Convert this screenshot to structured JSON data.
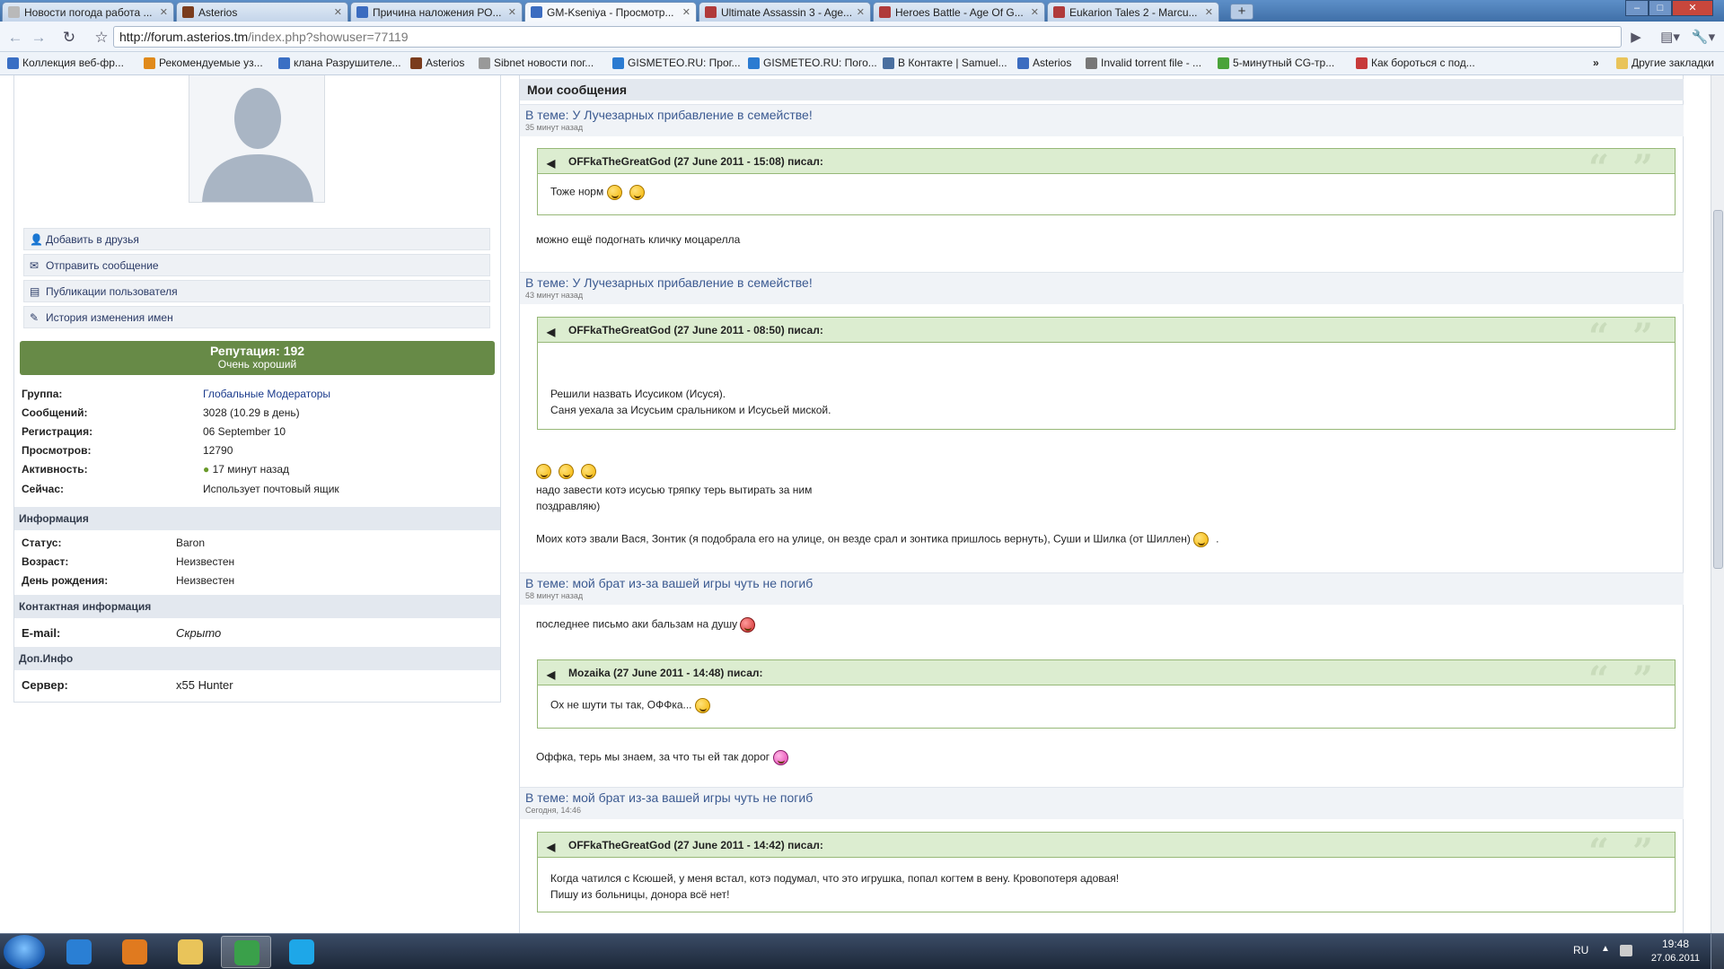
{
  "browser": {
    "tabs": [
      {
        "title": "Новости погода работа ...",
        "color": "#b9b9b9"
      },
      {
        "title": "Asterios",
        "color": "#7a3c1d"
      },
      {
        "title": "Причина наложения РО...",
        "color": "#3b6cc0"
      },
      {
        "title": "GM-Kseniya - Просмотр...",
        "color": "#3b6cc0"
      },
      {
        "title": "Ultimate Assassin 3 - Age...",
        "color": "#b03a3a"
      },
      {
        "title": "Heroes Battle - Age Of G...",
        "color": "#b03a3a"
      },
      {
        "title": "Eukarion Tales 2 - Marcu...",
        "color": "#b03a3a"
      }
    ],
    "active_tab": 3,
    "new_tab": "+",
    "url_host": "http://forum.asterios.tm",
    "url_path": "/index.php?showuser=77119",
    "window_controls": {
      "minimize": "–",
      "maximize": "□",
      "close": "✕"
    },
    "nav_icons": {
      "back": "back-arrow-icon",
      "forward": "forward-arrow-icon",
      "reload": "reload-icon",
      "star": "bookmark-star-icon"
    },
    "bookmarks": [
      {
        "label": "Коллекция веб-фр...",
        "color": "#3a6fc4"
      },
      {
        "label": "Рекомендуемые уз...",
        "color": "#e08a1b"
      },
      {
        "label": "клана Разрушителе...",
        "color": "#3a6fc4"
      },
      {
        "label": "Asterios",
        "color": "#7a3c1d"
      },
      {
        "label": "Sibnet новости пог...",
        "color": "#999999"
      },
      {
        "label": "GISMETEO.RU: Прог...",
        "color": "#2b7bd1"
      },
      {
        "label": "GISMETEO.RU: Пого...",
        "color": "#2b7bd1"
      },
      {
        "label": "В Контакте | Samuel...",
        "color": "#4a6f9f"
      },
      {
        "label": "Asterios",
        "color": "#3b6cc0"
      },
      {
        "label": "Invalid torrent file - ...",
        "color": "#777777"
      },
      {
        "label": "5-минутный CG-тр...",
        "color": "#4aa33a"
      },
      {
        "label": "Как бороться с под...",
        "color": "#c73a3a"
      }
    ],
    "bookmarks_more": "»",
    "other_bookmarks": "Другие закладки"
  },
  "profile": {
    "actions": [
      {
        "label": "Добавить в друзья",
        "icon": "add-friend-icon"
      },
      {
        "label": "Отправить сообщение",
        "icon": "envelope-icon"
      },
      {
        "label": "Публикации пользователя",
        "icon": "document-icon"
      },
      {
        "label": "История изменения имен",
        "icon": "pencil-icon"
      }
    ],
    "reputation_title": "Репутация: 192",
    "reputation_sub": "Очень хороший",
    "stats": [
      {
        "label": "Группа:",
        "value": "Глобальные Модераторы"
      },
      {
        "label": "Сообщений:",
        "value": "3028 (10.29 в день)"
      },
      {
        "label": "Регистрация:",
        "value": "06 September 10"
      },
      {
        "label": "Просмотров:",
        "value": "12790"
      },
      {
        "label": "Активность:",
        "value": "17 минут назад"
      },
      {
        "label": "Сейчас:",
        "value": "Использует почтовый ящик"
      }
    ],
    "info_title": "Информация",
    "info": [
      {
        "label": "Статус:",
        "value": "Baron"
      },
      {
        "label": "Возраст:",
        "value": "Неизвестен"
      },
      {
        "label": "День рождения:",
        "value": "Неизвестен"
      }
    ],
    "contact_title": "Контактная информация",
    "email_label": "E-mail:",
    "email_value": "Скрыто",
    "extra_title": "Доп.Инфо",
    "server_label": "Сервер:",
    "server_value": "x55 Hunter"
  },
  "messages": {
    "title": "Мои сообщения",
    "posts": [
      {
        "topic": "В теме: У Лучезарных прибавление в семействе!",
        "time": "35 минут назад",
        "quote_author": "OFFkaTheGreatGod (27 June 2011 - 15:08) писал:",
        "quote_lines": [
          "Тоже норм"
        ],
        "body": [
          "можно ещё подогнать кличку моцарелла"
        ]
      },
      {
        "topic": "В теме: У Лучезарных прибавление в семействе!",
        "time": "43 минут назад",
        "quote_author": "OFFkaTheGreatGod (27 June 2011 - 08:50) писал:",
        "quote_lines": [
          "Решили назвать Исусиком (Исуся).",
          "Саня уехала за Исусьим сральником и Исусьей миской."
        ],
        "body": [
          "надо завести котэ исусью тряпку терь вытирать за ним",
          "поздравляю)",
          "Моих котэ звали Вася, Зонтик (я подобрала его на улице, он везде срал и зонтика пришлось вернуть), Суши и Шилка (от Шиллен)",
          "."
        ]
      },
      {
        "topic": "В теме: мой брат из-за вашей игры чуть не погиб",
        "time": "58 минут назад",
        "pre": "последнее письмо аки бальзам на душу",
        "quote_author": "Mozaika (27 June 2011 - 14:48) писал:",
        "quote_lines": [
          "Ох не шути ты так, ОФФка..."
        ],
        "body": [
          "Оффка, терь мы знаем, за что ты ей так дорог"
        ]
      },
      {
        "topic": "В теме: мой брат из-за вашей игры чуть не погиб",
        "time": "Сегодня, 14:46",
        "quote_author": "OFFkaTheGreatGod (27 June 2011 - 14:42) писал:",
        "quote_lines": [
          "Когда чатился с Ксюшей, у меня встал, котэ подумал, что это игрушка, попал когтем в вену. Кровопотеря адовая!",
          "Пишу из больницы, донора всё нет!"
        ]
      }
    ]
  },
  "taskbar": {
    "apps": [
      {
        "icon": "internet-explorer-icon",
        "color": "#2a7fd4"
      },
      {
        "icon": "media-player-icon",
        "color": "#e07a1f"
      },
      {
        "icon": "folder-icon",
        "color": "#e9c45a"
      },
      {
        "icon": "chrome-icon",
        "color": "#3aa04a"
      },
      {
        "icon": "skype-icon",
        "color": "#1ea7e8"
      }
    ],
    "active_app": 3,
    "lang": "RU",
    "time": "19:48",
    "date": "27.06.2011"
  },
  "colors": {
    "reputation_bg": "#678a47",
    "quote_header_bg": "#dcedd0",
    "topic_link": "#3b5a91"
  }
}
